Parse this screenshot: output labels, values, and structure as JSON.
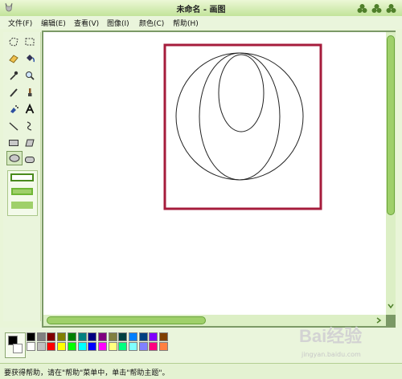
{
  "window": {
    "title": "未命名 - 画图"
  },
  "menu": {
    "items": [
      "文件(F)",
      "编辑(E)",
      "查看(V)",
      "图像(I)",
      "颜色(C)",
      "帮助(H)"
    ]
  },
  "toolbox": {
    "tools": [
      "free-select",
      "rect-select",
      "eraser",
      "fill",
      "color-picker",
      "magnifier",
      "pencil",
      "brush",
      "airbrush",
      "text",
      "line",
      "curve",
      "rectangle",
      "polygon",
      "ellipse",
      "rounded-rectangle"
    ],
    "selected": "ellipse"
  },
  "palette": {
    "foreground": "#000000",
    "background": "#ffffff",
    "row1": [
      "#000000",
      "#808080",
      "#800000",
      "#808000",
      "#008000",
      "#008080",
      "#000080",
      "#800080",
      "#808040",
      "#004040",
      "#0080ff",
      "#004080",
      "#8000ff",
      "#804000"
    ],
    "row2": [
      "#ffffff",
      "#c0c0c0",
      "#ff0000",
      "#ffff00",
      "#00ff00",
      "#00ffff",
      "#0000ff",
      "#ff00ff",
      "#ffff80",
      "#00ff80",
      "#80ffff",
      "#8080ff",
      "#ff0080",
      "#ff8040"
    ]
  },
  "drawing": {
    "highlight_color": "#a61c3c"
  },
  "status": {
    "text": "要获得帮助，请在\"帮助\"菜单中，单击\"帮助主题\"。"
  },
  "watermark": {
    "brand": "Bai经验",
    "url": "jingyan.baidu.com"
  }
}
